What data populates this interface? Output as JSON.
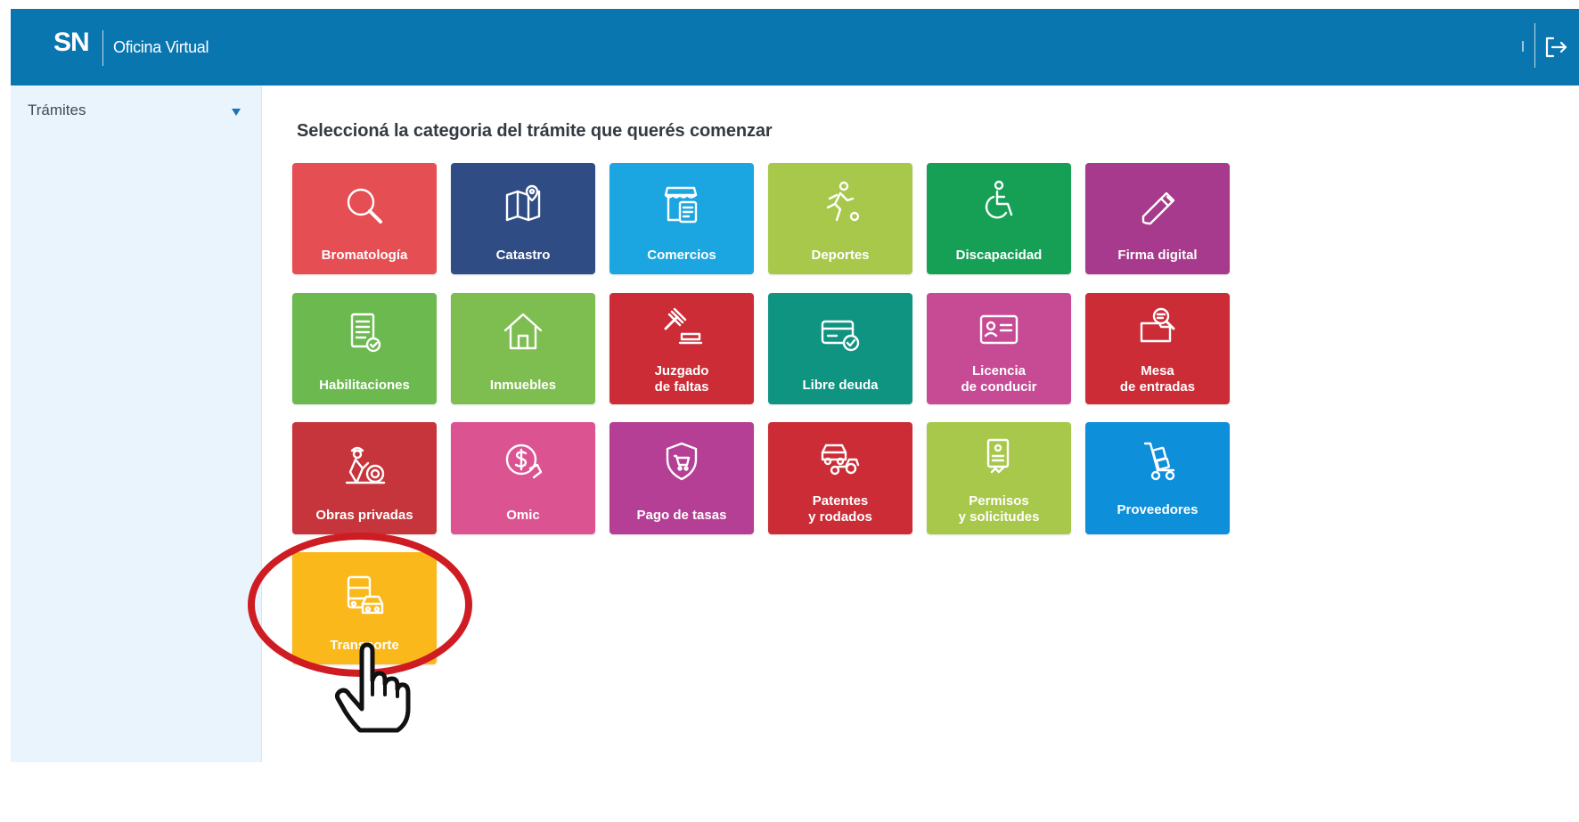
{
  "header": {
    "logo": "SN",
    "title": "Oficina Virtual",
    "logout_icon": "logout-icon"
  },
  "sidebar": {
    "items": [
      {
        "label": "Trámites",
        "icon": "caret-down-icon"
      }
    ]
  },
  "main": {
    "heading": "Seleccioná la categoria del trámite que querés comenzar",
    "tiles": [
      {
        "label": "Bromatología",
        "icon": "magnifier-icon",
        "color": "#e54f53"
      },
      {
        "label": "Catastro",
        "icon": "map-pin-icon",
        "color": "#2f4c84"
      },
      {
        "label": "Comercios",
        "icon": "storefront-icon",
        "color": "#1ba6e1"
      },
      {
        "label": "Deportes",
        "icon": "runner-icon",
        "color": "#a7c84a"
      },
      {
        "label": "Discapacidad",
        "icon": "wheelchair-icon",
        "color": "#15a056"
      },
      {
        "label": "Firma digital",
        "icon": "usb-key-icon",
        "color": "#a73a8d"
      },
      {
        "label": "Habilitaciones",
        "icon": "document-check-icon",
        "color": "#6bb94f"
      },
      {
        "label": "Inmuebles",
        "icon": "house-icon",
        "color": "#7ebd50"
      },
      {
        "label_line1": "Juzgado",
        "label_line2": "de faltas",
        "icon": "gavel-icon",
        "color": "#cc2c36"
      },
      {
        "label": "Libre deuda",
        "icon": "card-check-icon",
        "color": "#0f9482"
      },
      {
        "label_line1": "Licencia",
        "label_line2": "de conducir",
        "icon": "id-card-icon",
        "color": "#c74a95"
      },
      {
        "label_line1": "Mesa",
        "label_line2": "de entradas",
        "icon": "inbox-search-icon",
        "color": "#cc2c36"
      },
      {
        "label": "Obras privadas",
        "icon": "worker-icon",
        "color": "#c6353c"
      },
      {
        "label": "Omic",
        "icon": "dollar-hand-icon",
        "color": "#dc5391"
      },
      {
        "label": "Pago de tasas",
        "icon": "shield-cart-icon",
        "color": "#b43f94"
      },
      {
        "label_line1": "Patentes",
        "label_line2": "y rodados",
        "icon": "car-moto-icon",
        "color": "#cc2c36"
      },
      {
        "label_line1": "Permisos",
        "label_line2": "y solicitudes",
        "icon": "permit-doc-icon",
        "color": "#a7c84a"
      },
      {
        "label": "Proveedores",
        "icon": "hand-truck-icon",
        "color": "#0e8fda"
      },
      {
        "label": "Transporte",
        "icon": "bus-car-icon",
        "color": "#fbb81b"
      }
    ]
  },
  "overlay": {
    "highlight_color": "#cf1b22",
    "cursor_icon": "hand-pointer-icon"
  }
}
